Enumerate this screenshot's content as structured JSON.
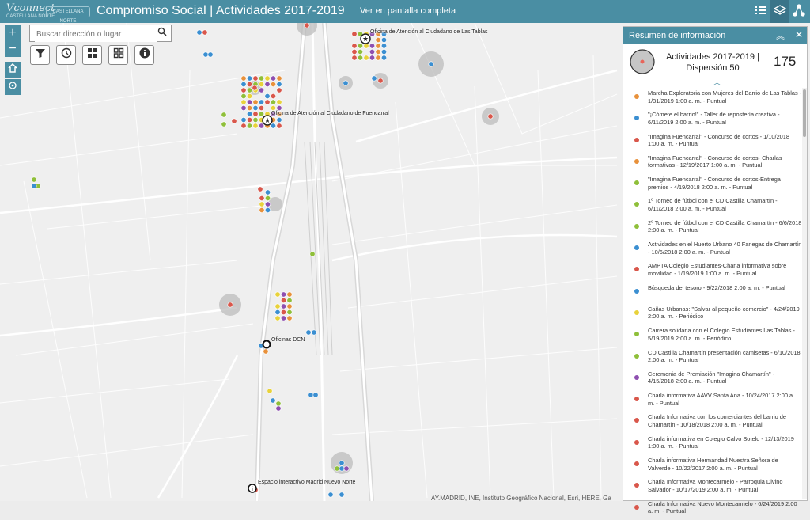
{
  "header": {
    "logo": "Vconnect",
    "logo_sub": "CASTELLANA NORTE",
    "logo2": "CASTELLANA NORTE",
    "title": "Compromiso Social | Actividades 2017-2019",
    "fullscreen": "Ver en pantalla completa"
  },
  "map": {
    "search_placeholder": "Buscar dirección o lugar",
    "labels": {
      "las_tablas": "Oficina de Atención al Ciudadano de Las Tablas",
      "fuencarral": "Oficina de Atención al Ciudadano de Fuencarral",
      "dcn": "Oficinas DCN",
      "nuevo_norte": "Espacio interactivo Madrid Nuevo Norte"
    },
    "attribution": "AY.MADRID, INE, Instituto Geográfico Nacional, Esri, HERE, Ga"
  },
  "colors": {
    "accent": "#4a8ea3",
    "orange": "#e8913b",
    "blue": "#3b8fd1",
    "red": "#d9574b",
    "green": "#8fbf3a",
    "yellow": "#e8d23b",
    "purple": "#8e4fb0"
  },
  "panel": {
    "title": "Resumen de información",
    "summary_name": "Actividades 2017-2019 | Dispersión 50",
    "summary_count": "175",
    "items": [
      {
        "text": "Marcha Exploratoria con Mujeres del Barrio de Las Tablas - 1/31/2019 1:00 a. m. - Puntual",
        "color": "#e8913b"
      },
      {
        "text": "\"¡Cómete el barrio!\" - Taller de repostería creativa - 6/11/2019 2:00 a. m. - Puntual",
        "color": "#3b8fd1"
      },
      {
        "text": "\"Imagina Fuencarral\" - Concurso de cortos - 1/10/2018 1:00 a. m. - Puntual",
        "color": "#d9574b"
      },
      {
        "text": "\"Imagina Fuencarral\" - Concurso de cortos- Charlas formativas - 12/19/2017 1:00 a. m. - Puntual",
        "color": "#e8913b"
      },
      {
        "text": "\"Imagina Fuencarral\" - Concurso de cortos-Entrega premios - 4/19/2018 2:00 a. m. - Puntual",
        "color": "#8fbf3a"
      },
      {
        "text": "1º Torneo de fútbol con el CD Castilla Chamartín - 6/11/2018 2:00 a. m. - Puntual",
        "color": "#8fbf3a"
      },
      {
        "text": "2º Torneo de fútbol con el CD Castilla Chamartín - 6/6/2018 2:00 a. m. - Puntual",
        "color": "#8fbf3a"
      },
      {
        "text": "Actividades en el Huerto Urbano 40 Fanegas de Chamartín - 10/6/2018 2:00 a. m. - Puntual",
        "color": "#3b8fd1"
      },
      {
        "text": "AMPTA Colegio Estudiantes-Charla informativa sobre movilidad - 1/19/2019 1:00 a. m. - Puntual",
        "color": "#d9574b"
      },
      {
        "text": "Búsqueda del tesoro - 9/22/2018 2:00 a. m. - Puntual",
        "color": "#3b8fd1"
      },
      {
        "text": "Cañas Urbanas: \"Salvar al pequeño comercio\" - 4/24/2019 2:00 a. m. - Periódico",
        "color": "#e8d23b"
      },
      {
        "text": "Carrera solidaria con el Colegio Estudiantes Las Tablas - 5/19/2019 2:00 a. m. - Periódico",
        "color": "#8fbf3a"
      },
      {
        "text": "CD Castilla Chamartín presentación camisetas - 6/10/2018 2:00 a. m. - Puntual",
        "color": "#8fbf3a"
      },
      {
        "text": "Ceremonia de Premiación \"Imagina Chamartín\" - 4/15/2018 2:00 a. m. - Puntual",
        "color": "#8e4fb0"
      },
      {
        "text": "Charla informativa AAVV Santa Ana - 10/24/2017 2:00 a. m. - Puntual",
        "color": "#d9574b"
      },
      {
        "text": "Charla Informativa con los comerciantes del barrio de Chamartín - 10/18/2018 2:00 a. m. - Puntual",
        "color": "#d9574b"
      },
      {
        "text": "Charla informativa en Colegio Calvo Sotelo - 12/13/2019 1:00 a. m. - Puntual",
        "color": "#d9574b"
      },
      {
        "text": "Charla informativa Hermandad Nuestra Señora de Valverde - 10/22/2017 2:00 a. m. - Puntual",
        "color": "#d9574b"
      },
      {
        "text": "Charla Informativa Montecarmelo - Parroquia Divino Salvador - 10/17/2019 2:00 a. m. - Puntual",
        "color": "#d9574b"
      },
      {
        "text": "Charla Informativa Nuevo Montecarmelo - 6/24/2019 2:00 a. m. - Puntual",
        "color": "#d9574b"
      }
    ]
  }
}
